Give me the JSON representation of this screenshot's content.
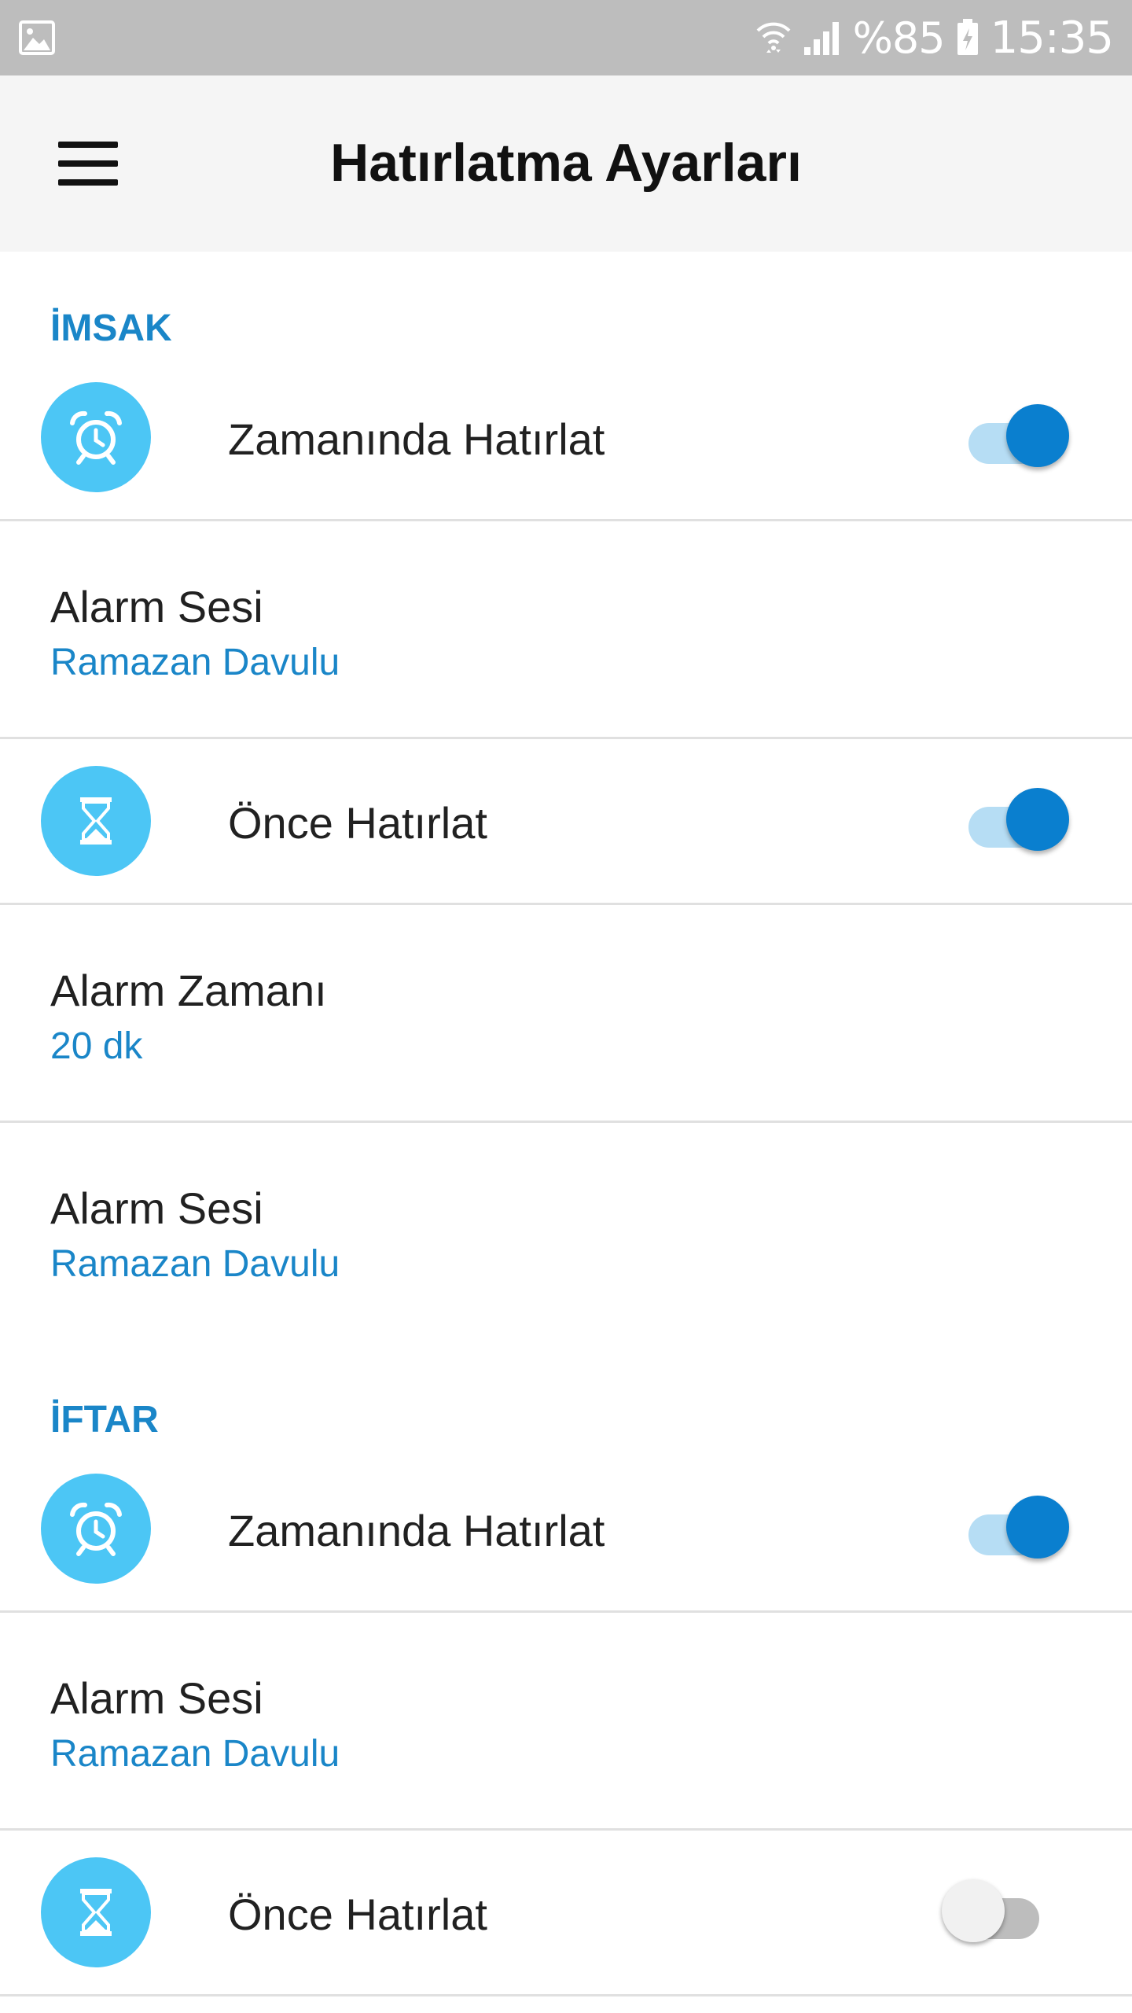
{
  "status_bar": {
    "battery": "%85",
    "time": "15:35"
  },
  "app_bar": {
    "title": "Hatırlatma Ayarları"
  },
  "imsak": {
    "header": "İMSAK",
    "on_time": {
      "label": "Zamanında Hatırlat",
      "enabled": true
    },
    "alarm_sound_1": {
      "title": "Alarm Sesi",
      "value": "Ramazan Davulu"
    },
    "before": {
      "label": "Önce Hatırlat",
      "enabled": true
    },
    "alarm_time": {
      "title": "Alarm Zamanı",
      "value": "20 dk"
    },
    "alarm_sound_2": {
      "title": "Alarm Sesi",
      "value": "Ramazan Davulu"
    }
  },
  "iftar": {
    "header": "İFTAR",
    "on_time": {
      "label": "Zamanında Hatırlat",
      "enabled": true
    },
    "alarm_sound_1": {
      "title": "Alarm Sesi",
      "value": "Ramazan Davulu"
    },
    "before": {
      "label": "Önce Hatırlat",
      "enabled": false
    }
  },
  "colors": {
    "accent": "#1a86c8",
    "icon_bg": "#4cc6f5",
    "toggle_on": "#0a7fcf"
  },
  "icons": [
    "gallery-icon",
    "wifi-icon",
    "signal-icon",
    "battery-icon",
    "menu-icon",
    "alarm-clock-icon",
    "hourglass-icon"
  ]
}
